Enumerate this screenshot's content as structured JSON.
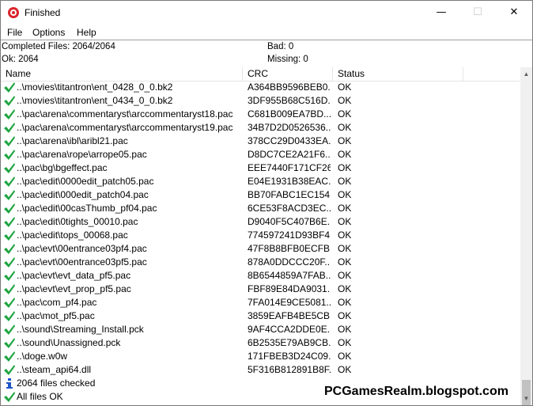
{
  "window": {
    "title": "Finished",
    "min_glyph": "—",
    "max_glyph": "☐",
    "close_glyph": "✕"
  },
  "menu": [
    "File",
    "Options",
    "Help"
  ],
  "summary": {
    "completed": "Completed Files: 2064/2064",
    "ok": "Ok: 2064",
    "bad": "Bad: 0",
    "missing": "Missing: 0"
  },
  "columns": {
    "name": "Name",
    "crc": "CRC",
    "status": "Status"
  },
  "rows": [
    {
      "icon": "check-icon",
      "name": "..\\movies\\titantron\\ent_0428_0_0.bk2",
      "crc": "A364BB9596BEB0...",
      "status": "OK"
    },
    {
      "icon": "check-icon",
      "name": "..\\movies\\titantron\\ent_0434_0_0.bk2",
      "crc": "3DF955B68C516D...",
      "status": "OK"
    },
    {
      "icon": "check-icon",
      "name": "..\\pac\\arena\\commentaryst\\arccommentaryst18.pac",
      "crc": "C681B009EA7BD...",
      "status": "OK"
    },
    {
      "icon": "check-icon",
      "name": "..\\pac\\arena\\commentaryst\\arccommentaryst19.pac",
      "crc": "34B7D2D0526536...",
      "status": "OK"
    },
    {
      "icon": "check-icon",
      "name": "..\\pac\\arena\\ibl\\aribl21.pac",
      "crc": "378CC29D0433EA...",
      "status": "OK"
    },
    {
      "icon": "check-icon",
      "name": "..\\pac\\arena\\rope\\arrope05.pac",
      "crc": "D8DC7CE2A21F6...",
      "status": "OK"
    },
    {
      "icon": "check-icon",
      "name": "..\\pac\\bg\\bgeffect.pac",
      "crc": "EEE7440F171CF26...",
      "status": "OK"
    },
    {
      "icon": "check-icon",
      "name": "..\\pac\\edit\\0000edit_patch05.pac",
      "crc": "E04E1931B38EAC...",
      "status": "OK"
    },
    {
      "icon": "check-icon",
      "name": "..\\pac\\edit\\000edit_patch04.pac",
      "crc": "BB70FABC1EC154...",
      "status": "OK"
    },
    {
      "icon": "check-icon",
      "name": "..\\pac\\edit\\00casThumb_pf04.pac",
      "crc": "6CE53F8ACD3EC...",
      "status": "OK"
    },
    {
      "icon": "check-icon",
      "name": "..\\pac\\edit\\0tights_00010.pac",
      "crc": "D9040F5C407B6E...",
      "status": "OK"
    },
    {
      "icon": "check-icon",
      "name": "..\\pac\\edit\\tops_00068.pac",
      "crc": "774597241D93BF4...",
      "status": "OK"
    },
    {
      "icon": "check-icon",
      "name": "..\\pac\\evt\\00entrance03pf4.pac",
      "crc": "47F8B8BFB0ECFB...",
      "status": "OK"
    },
    {
      "icon": "check-icon",
      "name": "..\\pac\\evt\\00entrance03pf5.pac",
      "crc": "878A0DDCCC20F...",
      "status": "OK"
    },
    {
      "icon": "check-icon",
      "name": "..\\pac\\evt\\evt_data_pf5.pac",
      "crc": "8B6544859A7FAB...",
      "status": "OK"
    },
    {
      "icon": "check-icon",
      "name": "..\\pac\\evt\\evt_prop_pf5.pac",
      "crc": "FBF89E84DA9031...",
      "status": "OK"
    },
    {
      "icon": "check-icon",
      "name": "..\\pac\\com_pf4.pac",
      "crc": "7FA014E9CE5081...",
      "status": "OK"
    },
    {
      "icon": "check-icon",
      "name": "..\\pac\\mot_pf5.pac",
      "crc": "3859EAFB4BE5CB...",
      "status": "OK"
    },
    {
      "icon": "check-icon",
      "name": "..\\sound\\Streaming_Install.pck",
      "crc": "9AF4CCA2DDE0E...",
      "status": "OK"
    },
    {
      "icon": "check-icon",
      "name": "..\\sound\\Unassigned.pck",
      "crc": "6B2535E79AB9CB...",
      "status": "OK"
    },
    {
      "icon": "check-icon",
      "name": "..\\doge.w0w",
      "crc": "171FBEB3D24C09...",
      "status": "OK"
    },
    {
      "icon": "check-icon",
      "name": "..\\steam_api64.dll",
      "crc": "5F316B812891B8F...",
      "status": "OK"
    },
    {
      "icon": "info-icon",
      "name": "2064 files checked",
      "crc": "",
      "status": ""
    },
    {
      "icon": "check-icon",
      "name": "All files OK",
      "crc": "",
      "status": ""
    }
  ],
  "scrollbar": {
    "up": "▲",
    "down": "▼"
  },
  "watermark": "PCGamesRealm.blogspot.com",
  "colors": {
    "check": "#1fa541",
    "info": "#1f55c8"
  }
}
